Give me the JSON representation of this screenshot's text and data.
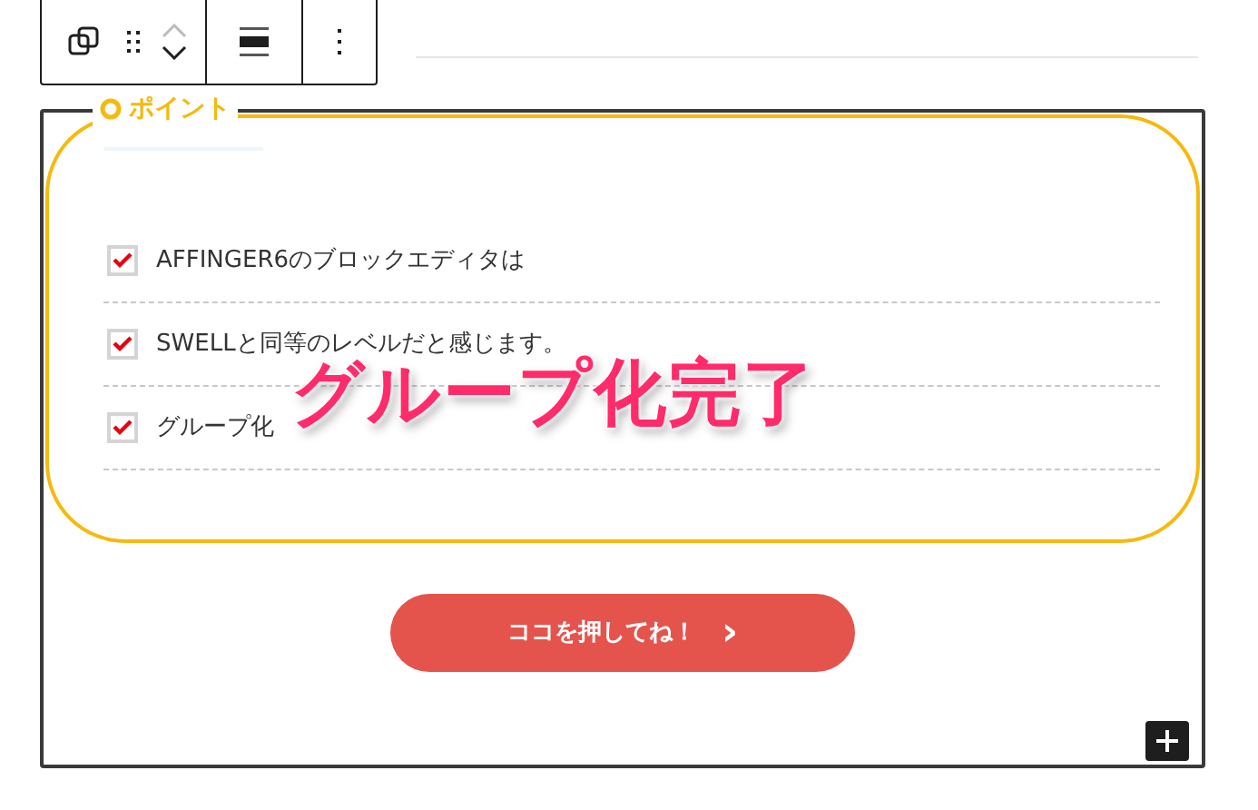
{
  "point_box": {
    "label": "ポイント",
    "items": [
      {
        "text": "AFFINGER6のブロックエディタは",
        "checked": true
      },
      {
        "text": "SWELLと同等のレベルだと感じます。",
        "checked": true
      },
      {
        "text": "グループ化",
        "checked": true
      }
    ]
  },
  "overlay_caption": "グループ化完了",
  "cta_button": {
    "label": "ココを押してね！",
    "arrow": "›"
  }
}
